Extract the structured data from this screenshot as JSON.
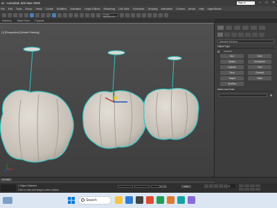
{
  "window": {
    "title": "ar - Autodesk 3ds Max 2020",
    "sign_in": "Sign In",
    "minimize": "–",
    "maximize": "□",
    "close": "✕"
  },
  "menu": [
    "File",
    "Edit",
    "Tools",
    "Group",
    "Views",
    "Create",
    "Modifiers",
    "Animation",
    "Graph Editors",
    "Rendering",
    "Civil View",
    "Customize",
    "Scripting",
    "Interactive",
    "Content",
    "Arnold",
    "Help",
    "ragamStudio"
  ],
  "toolbar": {
    "selection_set": "Create Selection Se"
  },
  "ribbon": [
    "Selection",
    "Object Paint",
    "Populate"
  ],
  "viewport": {
    "label": "[+] [Perspective] [Default Shading]"
  },
  "command_panel": {
    "category": "Standard Primitives",
    "object_type_title": "Object Type",
    "autogrid_label": "AutoGrid",
    "buttons": [
      "Box",
      "Cone",
      "Sphere",
      "GeoSphere",
      "Cylinder",
      "Tube",
      "Torus",
      "Pyramid",
      "Teapot",
      "Plane",
      "TextPlus"
    ],
    "name_color_title": "Name and Color",
    "name_value": "",
    "colors": {
      "swatch": "#8a8a8a"
    }
  },
  "timeline": {
    "frame": "0 / 100"
  },
  "status": {
    "selection": "1 Object Selected",
    "hint": "Click or click-and-drag to select objects",
    "auto_key": "Auto",
    "set_key": "Set Key",
    "frame_field": "0"
  },
  "taskbar": {
    "search_placeholder": "Search",
    "time": "",
    "date": ""
  },
  "colors": {
    "accent": "#4a7fb5",
    "selection_outline": "#2ec4c4",
    "mesh": "#c9c3bb"
  }
}
